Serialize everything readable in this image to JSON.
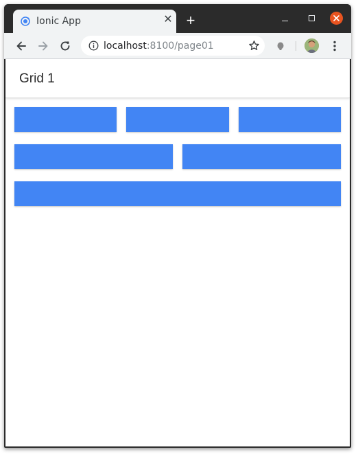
{
  "browser": {
    "tab": {
      "title": "Ionic App",
      "close_icon": "close-icon",
      "favicon": "ionic-logo-icon"
    },
    "new_tab_icon": "plus-icon",
    "window_controls": {
      "minimize_icon": "minimize-icon",
      "maximize_icon": "maximize-icon",
      "close_icon": "window-close-icon",
      "close_color": "#e95420"
    },
    "toolbar": {
      "back_icon": "arrow-left-icon",
      "forward_icon": "arrow-right-icon",
      "reload_icon": "reload-icon",
      "info_icon": "info-icon",
      "star_icon": "star-icon",
      "extension_icon": "extension-icon",
      "menu_icon": "more-vert-icon"
    },
    "address": {
      "host": "localhost",
      "path": ":8100/page01"
    }
  },
  "page": {
    "title": "Grid 1",
    "grid_color": "#4285f4",
    "rows": [
      {
        "columns": 3
      },
      {
        "columns": 2
      },
      {
        "columns": 1
      }
    ]
  }
}
